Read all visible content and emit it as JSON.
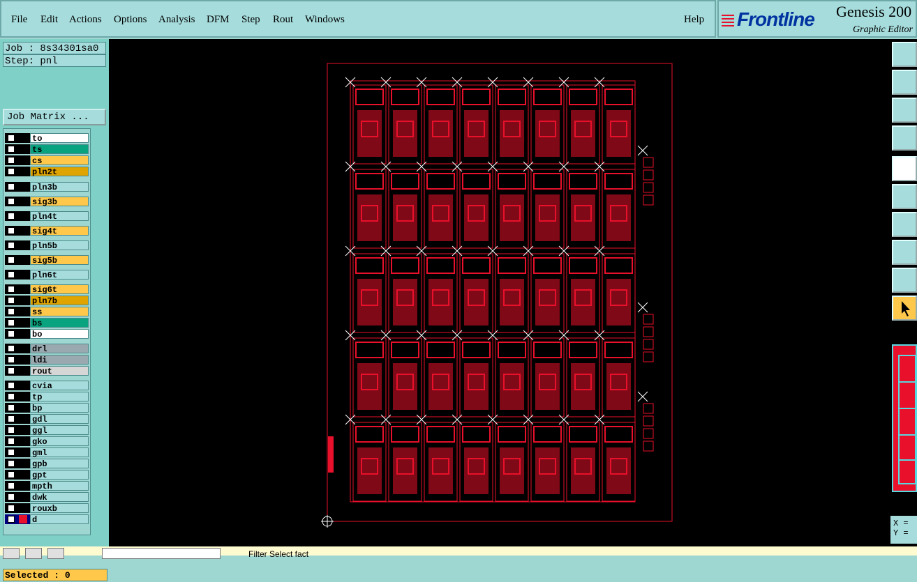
{
  "menubar": {
    "items": [
      "File",
      "Edit",
      "Actions",
      "Options",
      "Analysis",
      "DFM",
      "Step",
      "Rout",
      "Windows"
    ],
    "help": "Help"
  },
  "brand": {
    "logo": "Frontline",
    "product": "Genesis 200",
    "subtitle": "Graphic Editor"
  },
  "left": {
    "job": "Job : 8s34301sa0",
    "step": "Step: pnl",
    "job_matrix": "Job Matrix ...",
    "selected": "Selected : 0"
  },
  "layers": [
    {
      "name": "to",
      "color": "#ffffff"
    },
    {
      "name": "ts",
      "color": "#0aa37f"
    },
    {
      "name": "cs",
      "color": "#ffc84a"
    },
    {
      "name": "pln2t",
      "color": "#e0a400"
    },
    {
      "name": "pln3b",
      "color": "#a6dcdc"
    },
    {
      "name": "sig3b",
      "color": "#ffc84a"
    },
    {
      "name": "pln4t",
      "color": "#a6dcdc"
    },
    {
      "name": "sig4t",
      "color": "#ffc84a"
    },
    {
      "name": "pln5b",
      "color": "#a6dcdc"
    },
    {
      "name": "sig5b",
      "color": "#ffc84a"
    },
    {
      "name": "pln6t",
      "color": "#a6dcdc"
    },
    {
      "name": "sig6t",
      "color": "#ffc84a"
    },
    {
      "name": "pln7b",
      "color": "#e0a400"
    },
    {
      "name": "ss",
      "color": "#ffc84a"
    },
    {
      "name": "bs",
      "color": "#0aa37f"
    },
    {
      "name": "bo",
      "color": "#ffffff"
    },
    {
      "name": "drl",
      "color": "#9aa8b0"
    },
    {
      "name": "ldi",
      "color": "#9aa8b0"
    },
    {
      "name": "rout",
      "color": "#d6d6d6"
    },
    {
      "name": "cvia",
      "color": "#a6dcdc"
    },
    {
      "name": "tp",
      "color": "#a6dcdc"
    },
    {
      "name": "bp",
      "color": "#a6dcdc"
    },
    {
      "name": "gdl",
      "color": "#a6dcdc"
    },
    {
      "name": "ggl",
      "color": "#a6dcdc"
    },
    {
      "name": "gko",
      "color": "#a6dcdc"
    },
    {
      "name": "gml",
      "color": "#a6dcdc"
    },
    {
      "name": "gpb",
      "color": "#a6dcdc"
    },
    {
      "name": "gpt",
      "color": "#a6dcdc"
    },
    {
      "name": "mpth",
      "color": "#a6dcdc"
    },
    {
      "name": "dwk",
      "color": "#a6dcdc"
    },
    {
      "name": "rouxb",
      "color": "#a6dcdc"
    },
    {
      "name": "d",
      "color": "#a6dcdc"
    }
  ],
  "coords": {
    "x": "X =",
    "y": "Y ="
  },
  "status": {
    "msg": "Filter Select fact"
  },
  "colors": {
    "board": "#e8102a",
    "background": "#000000",
    "panel": "#a6dcdc",
    "highlight": "#ffc84a"
  }
}
